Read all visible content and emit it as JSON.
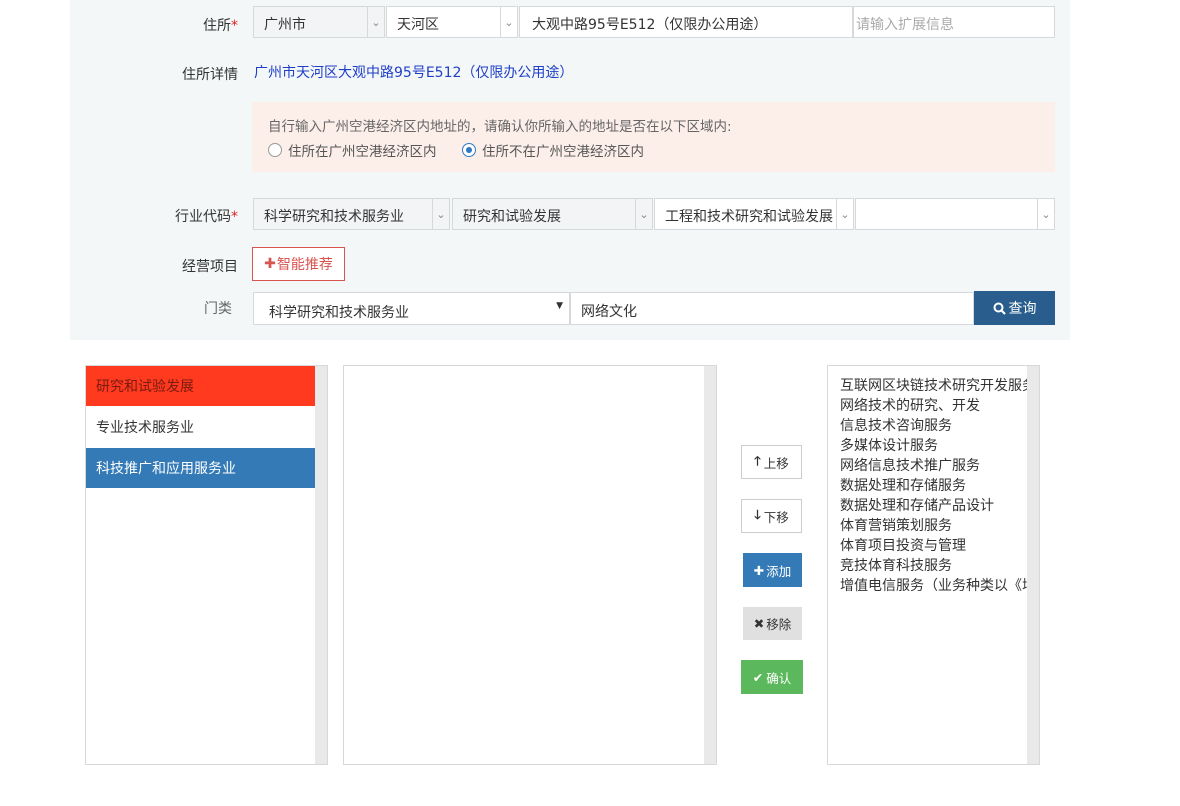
{
  "form": {
    "address": {
      "label": "住所",
      "required_mark": "*",
      "city": "广州市",
      "district": "天河区",
      "street": "大观中路95号E512（仅限办公用途）",
      "ext_placeholder": "请输入扩展信息"
    },
    "address_detail": {
      "label": "住所详情",
      "value": "广州市天河区大观中路95号E512（仅限办公用途）"
    },
    "notice": {
      "question": "自行输入广州空港经济区内地址的，请确认你所输入的地址是否在以下区域内:",
      "option_in": "住所在广州空港经济区内",
      "option_out": "住所不在广州空港经济区内",
      "selected": "option_out"
    },
    "industry": {
      "label": "行业代码",
      "required_mark": "*",
      "level1": "科学研究和技术服务业",
      "level2": "研究和试验发展",
      "level3": "工程和技术研究和试验发展",
      "level4": ""
    },
    "business": {
      "label": "经营项目",
      "smart_button": "智能推荐"
    },
    "category": {
      "label": "门类",
      "selected": "科学研究和技术服务业",
      "search_value": "网络文化",
      "query_button": "查询"
    }
  },
  "left_list": {
    "items": [
      {
        "label": "研究和试验发展",
        "state": "highlight"
      },
      {
        "label": "专业技术服务业",
        "state": "normal"
      },
      {
        "label": "科技推广和应用服务业",
        "state": "selected"
      }
    ]
  },
  "middle_list": {
    "items": []
  },
  "buttons": {
    "up": "上移",
    "down": "下移",
    "add": "添加",
    "remove": "移除",
    "confirm": "确认"
  },
  "right_list": {
    "items": [
      "互联网区块链技术研究开发服务",
      "网络技术的研究、开发",
      "信息技术咨询服务",
      "多媒体设计服务",
      "网络信息技术推广服务",
      "数据处理和存储服务",
      "数据处理和存储产品设计",
      "体育营销策划服务",
      "体育项目投资与管理",
      "竞技体育科技服务",
      "增值电信服务（业务种类以《增值电信业务经营许可证》载明内容为准）"
    ]
  },
  "colors": {
    "highlight": "#ff3a1f",
    "selected": "#337ab7",
    "primary_dark": "#285d8e",
    "success": "#5cb85c",
    "danger": "#d9534f",
    "notice_bg": "#fcefe9",
    "panel_bg": "#f4f7f8"
  },
  "icons": {
    "caret": "chevron-down-icon",
    "smart": "plus-icon",
    "query": "search-icon",
    "up": "arrow-up-icon",
    "down": "arrow-down-icon",
    "add": "plus-icon",
    "remove": "times-icon",
    "confirm": "check-icon"
  }
}
